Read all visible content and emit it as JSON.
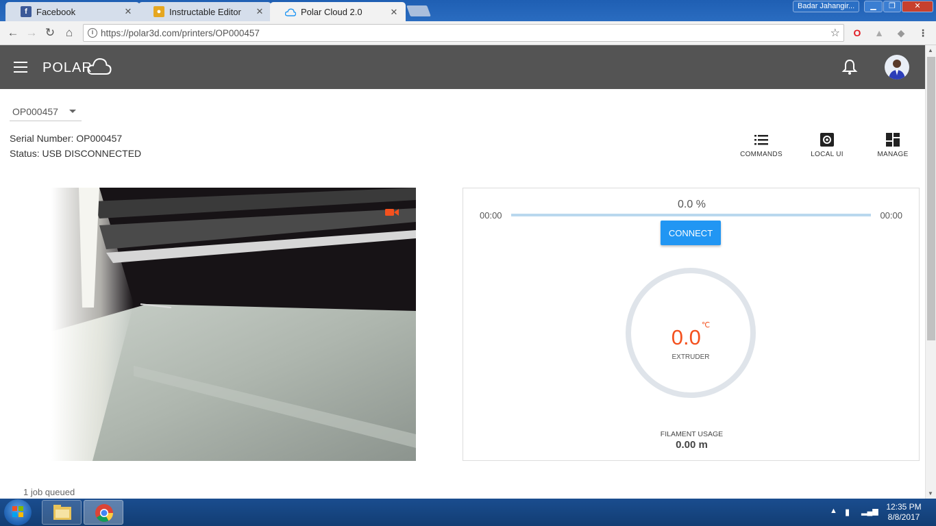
{
  "browser": {
    "tabs": [
      {
        "title": "Facebook",
        "favicon": "facebook-icon"
      },
      {
        "title": "Instructable Editor",
        "favicon": "instructables-icon"
      },
      {
        "title": "Polar Cloud 2.0",
        "favicon": "cloud-icon"
      }
    ],
    "user_badge": "Badar Jahangir...",
    "url": "https://polar3d.com/printers/OP000457"
  },
  "app": {
    "logo": "POLAR",
    "colors": {
      "header_bg": "#545454",
      "accent": "#2196f3",
      "temperature": "#f4511e"
    }
  },
  "printer": {
    "selected": "OP000457",
    "serial_label": "Serial Number:",
    "serial_value": "OP000457",
    "status_label": "Status:",
    "status_value": "USB DISCONNECTED"
  },
  "actions": [
    {
      "label": "COMMANDS",
      "icon": "list-icon"
    },
    {
      "label": "LOCAL UI",
      "icon": "local-ui-icon"
    },
    {
      "label": "MANAGE",
      "icon": "dashboard-icon"
    }
  ],
  "print_panel": {
    "progress_text": "0.0 %",
    "progress_fraction": 0.0,
    "elapsed": "00:00",
    "remaining": "00:00",
    "connect_label": "CONNECT",
    "temperature": "0.0",
    "temperature_unit": "℃",
    "temperature_label": "EXTRUDER",
    "filament_label": "FILAMENT USAGE",
    "filament_value": "0.00 m"
  },
  "jobs_text": "1 job queued",
  "taskbar": {
    "time": "12:35 PM",
    "date": "8/8/2017"
  }
}
